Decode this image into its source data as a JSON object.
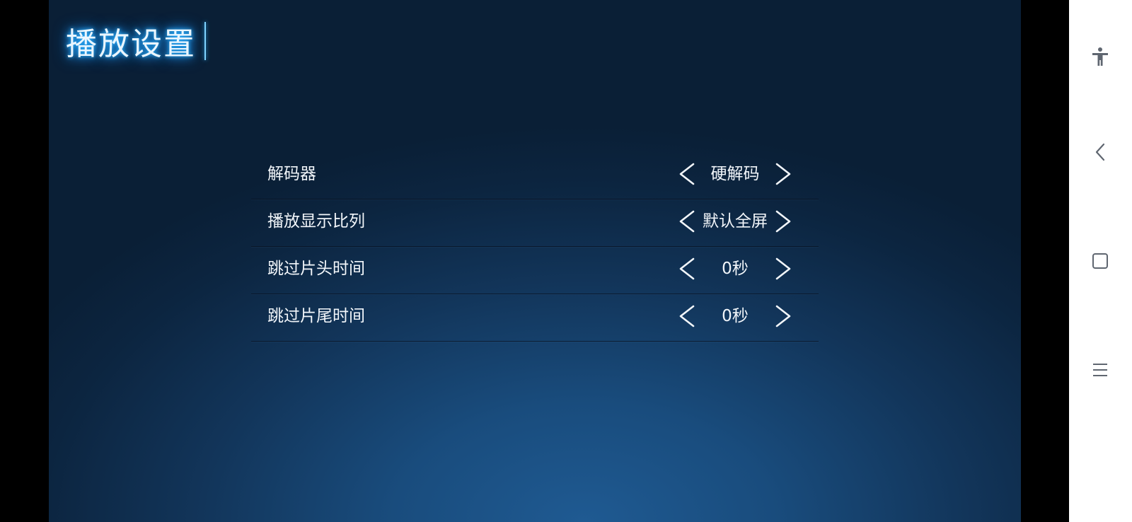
{
  "page": {
    "title": "播放设置"
  },
  "settings": [
    {
      "label": "解码器",
      "value": "硬解码"
    },
    {
      "label": "播放显示比列",
      "value": "默认全屏"
    },
    {
      "label": "跳过片头时间",
      "value": "0秒"
    },
    {
      "label": "跳过片尾时间",
      "value": "0秒"
    }
  ],
  "icons": {
    "prev": "chevron-left-icon",
    "next": "chevron-right-icon",
    "nav_accessibility": "accessibility-icon",
    "nav_back": "back-icon",
    "nav_home": "home-square-icon",
    "nav_menu": "menu-icon"
  },
  "colors": {
    "background_center": "#1f5a92",
    "background_edge": "#0a1f36",
    "title_glow": "#2fb6ff",
    "text": "#f2f6fa",
    "navbar": "#ffffff",
    "nav_icon": "#5f6670"
  }
}
